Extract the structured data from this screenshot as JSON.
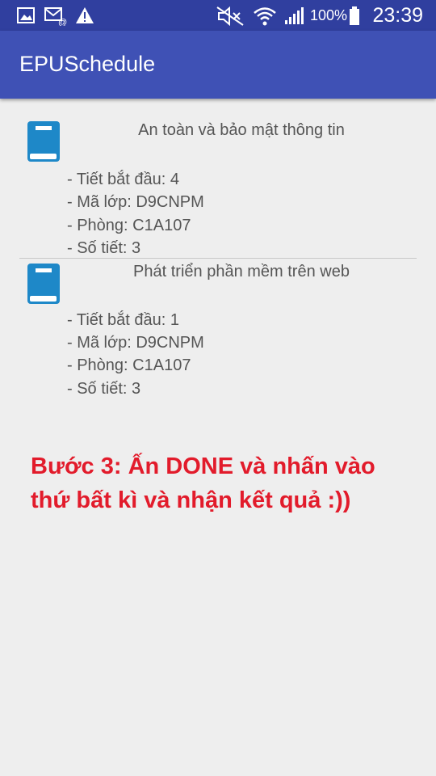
{
  "status_bar": {
    "icons": [
      "image-icon",
      "mail-icon",
      "warning-icon",
      "mute-icon",
      "wifi-icon",
      "signal-icon",
      "battery-icon"
    ],
    "battery": "100%",
    "time": "23:39"
  },
  "app_bar": {
    "title": "EPUSchedule"
  },
  "colors": {
    "primary": "#3f51b5",
    "primary_dark": "#303f9f",
    "book_icon": "#1e88c8",
    "note_text": "#e21b2b"
  },
  "courses": [
    {
      "title": "An toàn và bảo mật thông tin",
      "icon": "book-icon",
      "start_period": "- Tiết bắt đầu: 4",
      "class_code": "- Mã lớp: D9CNPM",
      "room": "- Phòng: C1A107",
      "periods": "- Số tiết: 3"
    },
    {
      "title": "Phát triển phần mềm trên web",
      "icon": "book-icon",
      "start_period": "- Tiết bắt đầu: 1",
      "class_code": "- Mã lớp: D9CNPM",
      "room": "- Phòng: C1A107",
      "periods": "- Số tiết: 3"
    }
  ],
  "note": "Bước 3: Ấn DONE và nhấn vào thứ bất kì và nhận kết quả :))"
}
